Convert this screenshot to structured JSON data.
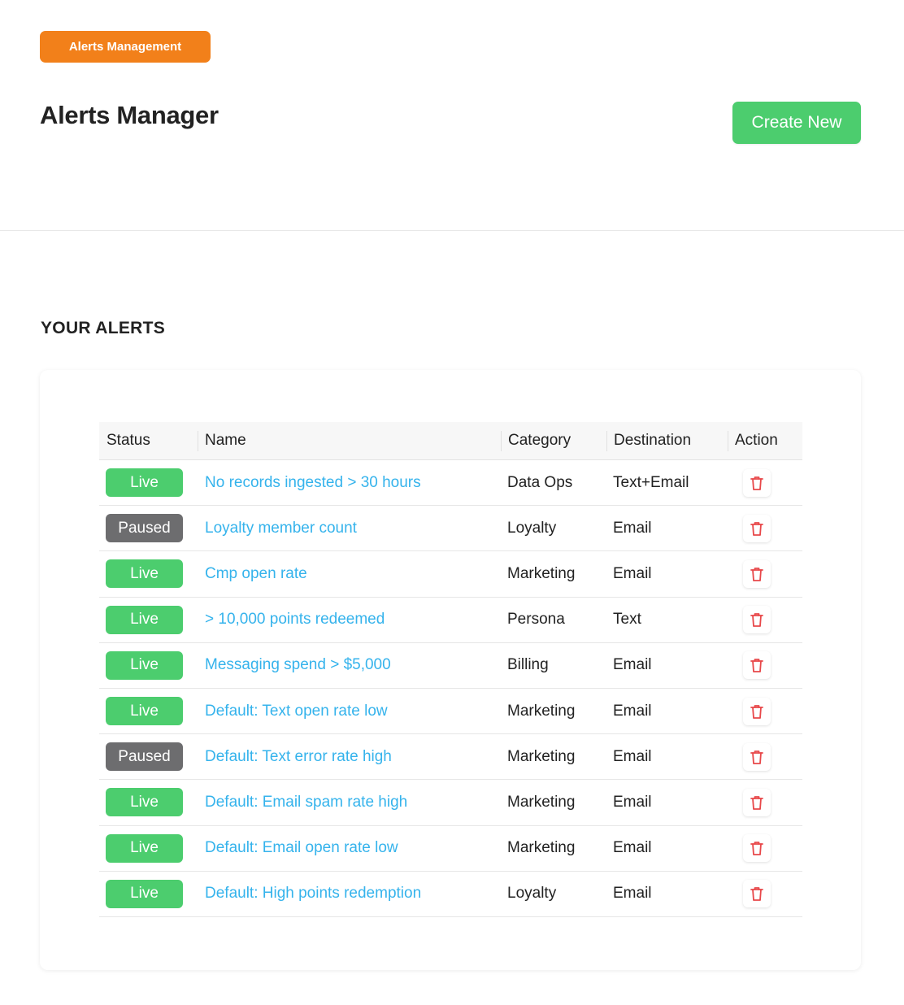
{
  "header": {
    "tag": "Alerts Management",
    "title": "Alerts Manager",
    "create_label": "Create New"
  },
  "section": {
    "heading": "YOUR ALERTS"
  },
  "table": {
    "columns": [
      "Status",
      "Name",
      "Category",
      "Destination",
      "Action"
    ],
    "rows": [
      {
        "status": "Live",
        "name": "No records ingested > 30 hours",
        "category": "Data Ops",
        "destination": "Text+Email"
      },
      {
        "status": "Paused",
        "name": "Loyalty member count",
        "category": "Loyalty",
        "destination": "Email"
      },
      {
        "status": "Live",
        "name": "Cmp open rate",
        "category": "Marketing",
        "destination": "Email"
      },
      {
        "status": "Live",
        "name": "> 10,000 points redeemed",
        "category": "Persona",
        "destination": "Text"
      },
      {
        "status": "Live",
        "name": "Messaging spend > $5,000",
        "category": "Billing",
        "destination": "Email"
      },
      {
        "status": "Live",
        "name": "Default: Text open rate low",
        "category": "Marketing",
        "destination": "Email"
      },
      {
        "status": "Paused",
        "name": "Default: Text error rate high",
        "category": "Marketing",
        "destination": "Email"
      },
      {
        "status": "Live",
        "name": "Default: Email spam rate high",
        "category": "Marketing",
        "destination": "Email"
      },
      {
        "status": "Live",
        "name": "Default: Email open rate low",
        "category": "Marketing",
        "destination": "Email"
      },
      {
        "status": "Live",
        "name": "Default: High points redemption",
        "category": "Loyalty",
        "destination": "Email"
      }
    ],
    "action_icon": "trash-icon"
  },
  "colors": {
    "tag_bg": "#f2801a",
    "primary_green": "#4ccd6e",
    "paused_gray": "#6d6d6f",
    "link_blue": "#35b3ec",
    "delete_red": "#e8484a"
  }
}
